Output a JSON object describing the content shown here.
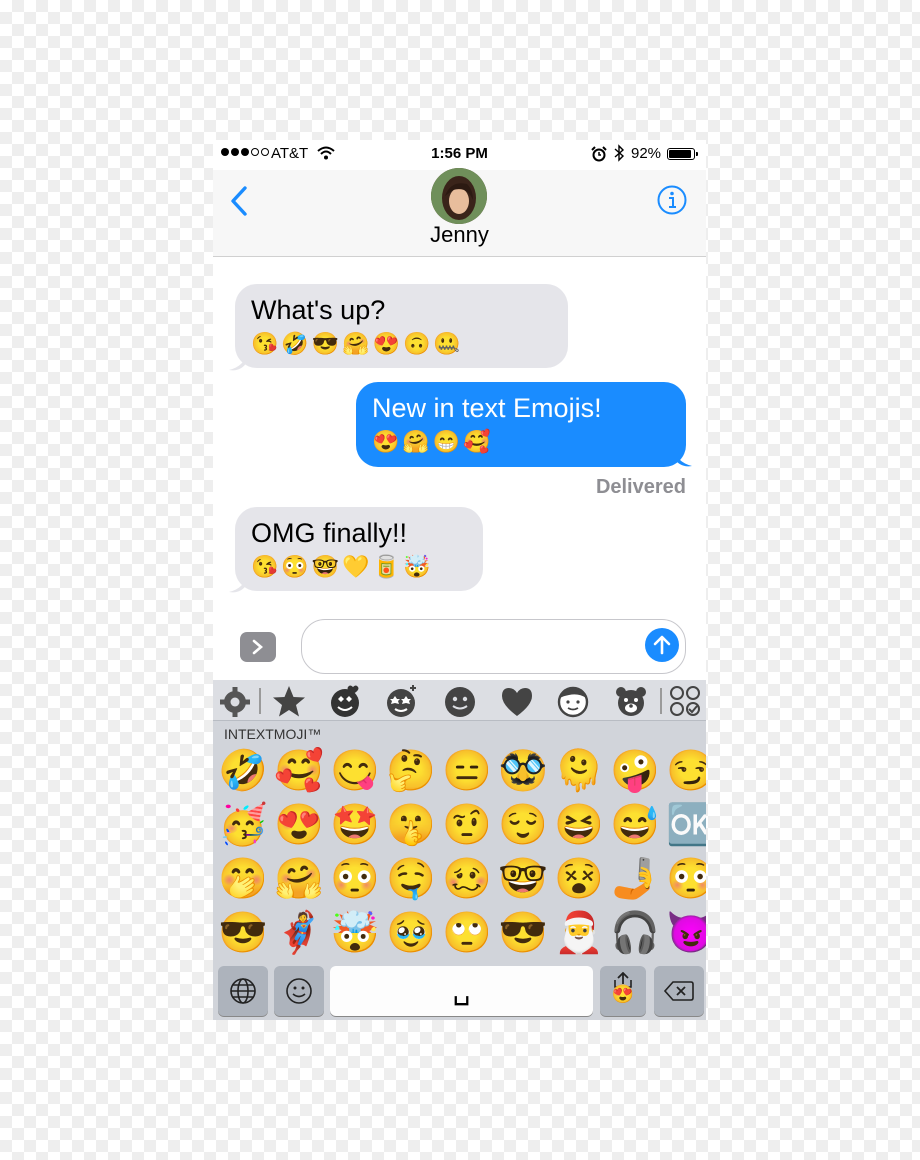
{
  "status_bar": {
    "signal_dots": 5,
    "signal_filled": 3,
    "carrier": "AT&T",
    "time": "1:56 PM",
    "battery_text": "92%",
    "battery_level": 0.92
  },
  "nav": {
    "back_icon": "chevron-left-icon",
    "contact_name": "Jenny",
    "info_icon": "info-icon",
    "accent_color": "#1a8cff"
  },
  "messages": [
    {
      "direction": "received",
      "text": "What's up?",
      "emoji": "😘🤣😎🤗😍🙃🤐"
    },
    {
      "direction": "sent",
      "text": "New in text Emojis!",
      "emoji": "😍🤗😁🥰"
    },
    {
      "direction": "received",
      "text": "OMG finally!!",
      "emoji": "😘😳🤓💛🥫🤯"
    }
  ],
  "delivery_status": "Delivered",
  "composer": {
    "placeholder": "",
    "apps_icon": "chevron-right-icon",
    "send_icon": "arrow-up-icon"
  },
  "keyboard": {
    "categories": [
      "gear-icon",
      "star-icon",
      "love-face-icon",
      "sparkle-face-icon",
      "smiley-icon",
      "heart-icon",
      "person-icon",
      "bear-icon",
      "grid-icon"
    ],
    "section_title": "INTEXTMOJI™",
    "emoji_rows": [
      [
        "🤣",
        "🥰",
        "😋",
        "🤔",
        "😑",
        "🥸",
        "🫠",
        "🤪",
        "😏",
        "😀"
      ],
      [
        "🥳",
        "😍",
        "🤩",
        "🤫",
        "🤨",
        "😌",
        "😆",
        "😅",
        "🆗",
        "😀"
      ],
      [
        "🤭",
        "🤗",
        "😳",
        "🤤",
        "🥴",
        "🤓",
        "😵",
        "🤳",
        "😳",
        "😀"
      ],
      [
        "😎",
        "🦸",
        "🤯",
        "🥹",
        "🙄",
        "😎",
        "🎅",
        "🎧",
        "😈",
        "🤎"
      ]
    ],
    "bottom_keys": {
      "globe_icon": "globe-icon",
      "emoji_icon": "smiley-icon",
      "space_glyph": "␣",
      "share_emoji": "😍",
      "delete_icon": "backspace-icon"
    }
  }
}
